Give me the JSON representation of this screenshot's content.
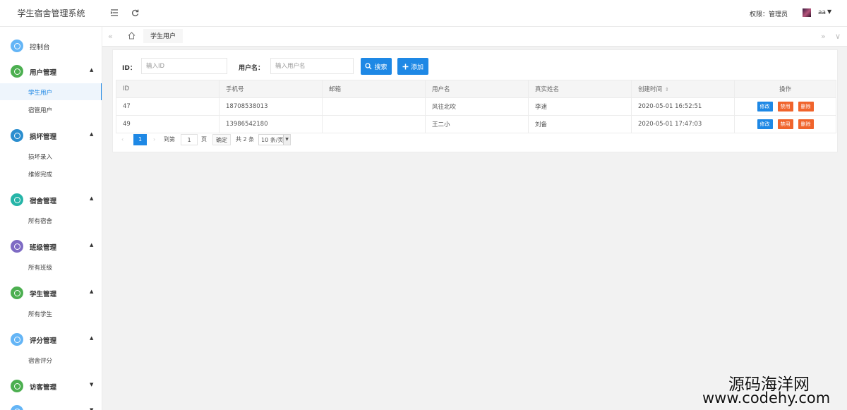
{
  "app": {
    "title": "学生宿舍管理系统"
  },
  "header": {
    "menu_icon": "menu-fold-icon",
    "refresh_icon": "refresh-icon",
    "permission": "权限：管理员",
    "username": "aa",
    "caret": "▼"
  },
  "sidebar": {
    "groups": [
      {
        "label": "控制台",
        "icon": "home-icon",
        "color": "#64b5f6",
        "bold": false,
        "arrow": "",
        "items": []
      },
      {
        "label": "用户管理",
        "icon": "user-icon",
        "color": "#4caf50",
        "bold": true,
        "arrow": "▲",
        "items": [
          {
            "label": "学生用户",
            "active": true
          },
          {
            "label": "宿管用户",
            "active": false
          }
        ]
      },
      {
        "label": "损坏管理",
        "icon": "damage-icon",
        "color": "#2b8ecf",
        "bold": true,
        "arrow": "▲",
        "items": [
          {
            "label": "损坏录入",
            "active": false
          },
          {
            "label": "维修完成",
            "active": false
          }
        ]
      },
      {
        "label": "宿舍管理",
        "icon": "dorm-icon",
        "color": "#26b5a8",
        "bold": true,
        "arrow": "▲",
        "items": [
          {
            "label": "所有宿舍",
            "active": false
          }
        ]
      },
      {
        "label": "班级管理",
        "icon": "class-icon",
        "color": "#7e6bc4",
        "bold": true,
        "arrow": "▲",
        "items": [
          {
            "label": "所有班级",
            "active": false
          }
        ]
      },
      {
        "label": "学生管理",
        "icon": "student-icon",
        "color": "#4caf50",
        "bold": true,
        "arrow": "▲",
        "items": [
          {
            "label": "所有学生",
            "active": false
          }
        ]
      },
      {
        "label": "评分管理",
        "icon": "rating-icon",
        "color": "#64b5f6",
        "bold": true,
        "arrow": "▲",
        "items": [
          {
            "label": "宿舍评分",
            "active": false
          }
        ]
      },
      {
        "label": "访客管理",
        "icon": "visitor-icon",
        "color": "#4caf50",
        "bold": true,
        "arrow": "▼",
        "items": []
      },
      {
        "label": "",
        "icon": "more-icon",
        "color": "#64b5f6",
        "bold": true,
        "arrow": "▼",
        "items": []
      }
    ]
  },
  "tabs": {
    "prev": "«",
    "next": "»",
    "dropdown": "∨",
    "active": "学生用户"
  },
  "filters": {
    "id_label": "ID：",
    "id_placeholder": "输入ID",
    "username_label": "用户名：",
    "username_placeholder": "输入用户名",
    "search_label": "搜索",
    "add_label": "添加"
  },
  "table": {
    "columns": [
      "ID",
      "手机号",
      "邮箱",
      "用户名",
      "真实姓名",
      "创建时间",
      "操作"
    ],
    "sort_glyph": "⇕",
    "rows": [
      {
        "id": "47",
        "phone": "18708538013",
        "email": "",
        "username": "风往北吹",
        "realname": "李速",
        "created": "2020-05-01 16:52:51"
      },
      {
        "id": "49",
        "phone": "13986542180",
        "email": "",
        "username": "王二小",
        "realname": "刘备",
        "created": "2020-05-01 17:47:03"
      }
    ],
    "actions": {
      "edit": "修改",
      "disable": "禁用",
      "delete": "删除"
    }
  },
  "pager": {
    "prev": "‹",
    "current": "1",
    "next": "›",
    "goto_label": "到第",
    "goto_value": "1",
    "page_unit": "页",
    "confirm": "确定",
    "total": "共 2 条",
    "page_size": "10 条/页"
  },
  "watermark": {
    "line1": "源码海洋网",
    "line2": "www.codehy.com"
  }
}
